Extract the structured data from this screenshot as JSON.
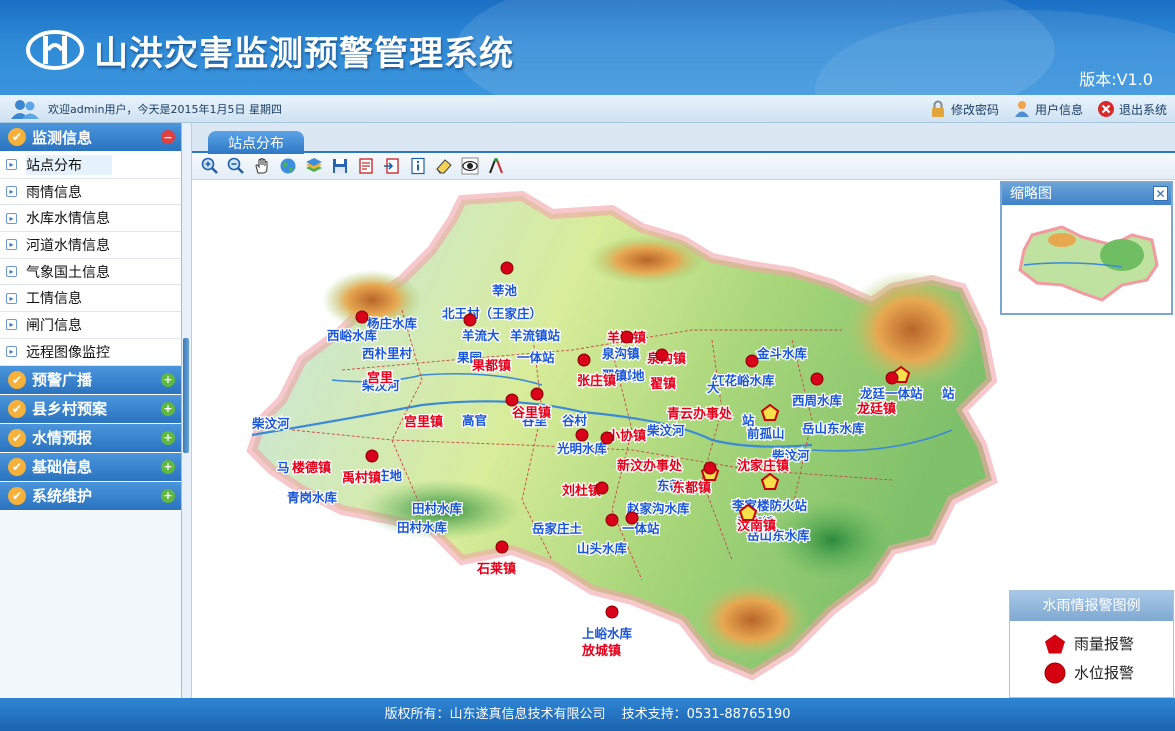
{
  "header": {
    "title": "山洪灾害监测预警管理系统",
    "version": "版本:V1.0",
    "accent_color": "#2f8ad6"
  },
  "userbar": {
    "welcome": "欢迎admin用户，今天是2015年1月5日 星期四",
    "actions": [
      {
        "label": "修改密码",
        "icon": "lock-icon"
      },
      {
        "label": "用户信息",
        "icon": "user-icon"
      },
      {
        "label": "退出系统",
        "icon": "exit-icon"
      }
    ]
  },
  "sidebar": {
    "sections": [
      {
        "label": "监测信息",
        "expanded": true,
        "items": [
          "站点分布",
          "雨情信息",
          "水库水情信息",
          "河道水情信息",
          "气象国土信息",
          "工情信息",
          "闸门信息",
          "远程图像监控"
        ]
      },
      {
        "label": "预警广播",
        "expanded": false
      },
      {
        "label": "县乡村预案",
        "expanded": false
      },
      {
        "label": "水情预报",
        "expanded": false
      },
      {
        "label": "基础信息",
        "expanded": false
      },
      {
        "label": "系统维护",
        "expanded": false
      }
    ],
    "active_item": "站点分布"
  },
  "content": {
    "tab": "站点分布",
    "toolbar": [
      "zoom-in-icon",
      "zoom-out-icon",
      "pan-hand-icon",
      "globe-icon",
      "layers-icon",
      "save-icon",
      "print-icon",
      "export-icon",
      "info-icon",
      "eraser-icon",
      "eye-icon",
      "measure-icon"
    ]
  },
  "map": {
    "labels_blue": [
      "莘池",
      "北王村（王家庄）",
      "杨庄水库",
      "西峪水库",
      "西朴里村",
      "羊流大",
      "羊流镇站",
      "果园",
      "一体站",
      "泉沟镇",
      "翟镇站",
      "地",
      "金斗水库",
      "红花峪水库",
      "龙廷一体站",
      "西周水库",
      "柴汶河",
      "柴汶河",
      "高官",
      "谷里",
      "光明水库",
      "柴汶河",
      "谷村",
      "站",
      "前孤山",
      "岳山东水库",
      "柴汶河",
      "马",
      "庄地",
      "青岗水库",
      "东都",
      "李家楼防火站",
      "田村水库",
      "田村水库",
      "岳家庄土",
      "一体站",
      "赵家沟水库",
      "山头水库",
      "汶南镇",
      "岳山东水库",
      "上峪水库",
      "大",
      "站"
    ],
    "labels_red": [
      "果都镇",
      "张庄镇",
      "泉沟镇",
      "翟镇",
      "宫里镇",
      "谷里镇",
      "羊流镇",
      "青云办事处",
      "龙廷镇",
      "小协镇",
      "新汶办事处",
      "沈家庄镇",
      "楼德镇",
      "禹村镇",
      "刘杜镇",
      "东都镇",
      "汶南镇",
      "石莱镇",
      "放城镇",
      "宫里"
    ],
    "overview_title": "缩略图",
    "legend": {
      "title": "水雨情报警图例",
      "items": [
        {
          "label": "雨量报警",
          "icon": "pentagon-icon",
          "color": "#d4000f"
        },
        {
          "label": "水位报警",
          "icon": "circle-icon",
          "color": "#d4000f"
        }
      ]
    }
  },
  "footer": {
    "copyright": "版权所有：山东遂真信息技术有限公司",
    "support": "技术支持：0531-88765190"
  }
}
